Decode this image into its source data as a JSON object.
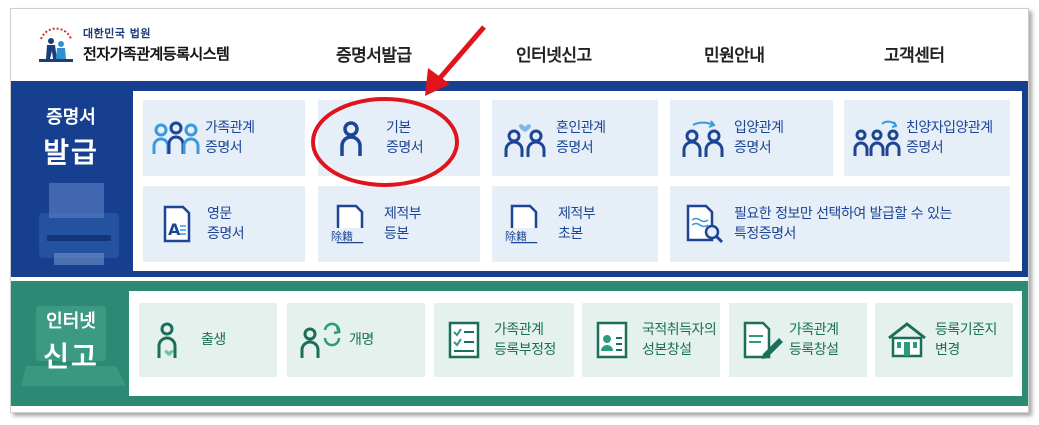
{
  "header": {
    "logo_sub": "대한민국 법원",
    "logo_main": "전자가족관계등록시스템",
    "nav": [
      "증명서발급",
      "인터넷신고",
      "민원안내",
      "고객센터"
    ]
  },
  "certificate": {
    "label_line1": "증명서",
    "label_line2": "발급",
    "cards": [
      {
        "line1": "가족관계",
        "line2": "증명서",
        "icon": "family-icon"
      },
      {
        "line1": "기본",
        "line2": "증명서",
        "icon": "person-icon"
      },
      {
        "line1": "혼인관계",
        "line2": "증명서",
        "icon": "marriage-icon"
      },
      {
        "line1": "입양관계",
        "line2": "증명서",
        "icon": "adoption-icon"
      },
      {
        "line1": "친양자입양관계",
        "line2": "증명서",
        "icon": "full-adoption-icon"
      },
      {
        "line1": "영문",
        "line2": "증명서",
        "icon": "english-document-icon"
      },
      {
        "line1": "제적부",
        "line2": "등본",
        "icon": "removed-register-icon",
        "tag": "除籍"
      },
      {
        "line1": "제적부",
        "line2": "초본",
        "icon": "removed-register-icon",
        "tag": "除籍"
      },
      {
        "line1": "필요한 정보만 선택하여 발급할 수 있는",
        "line2": "특정증명서",
        "icon": "document-search-icon"
      }
    ]
  },
  "report": {
    "label_line1": "인터넷",
    "label_line2": "신고",
    "cards": [
      {
        "line1": "출생",
        "line2": "",
        "icon": "birth-icon"
      },
      {
        "line1": "개명",
        "line2": "",
        "icon": "name-change-icon"
      },
      {
        "line1": "가족관계",
        "line2": "등록부정정",
        "icon": "checklist-icon"
      },
      {
        "line1": "국적취득자의",
        "line2": "성본창설",
        "icon": "id-card-icon"
      },
      {
        "line1": "가족관계",
        "line2": "등록창설",
        "icon": "document-pen-icon"
      },
      {
        "line1": "등록기준지",
        "line2": "변경",
        "icon": "house-icon"
      }
    ]
  },
  "colors": {
    "blue": "#16408f",
    "green": "#2c8a74",
    "card_blue": "#e6eef8",
    "card_green": "#e4f1ec",
    "annotation_red": "#e0141d"
  }
}
